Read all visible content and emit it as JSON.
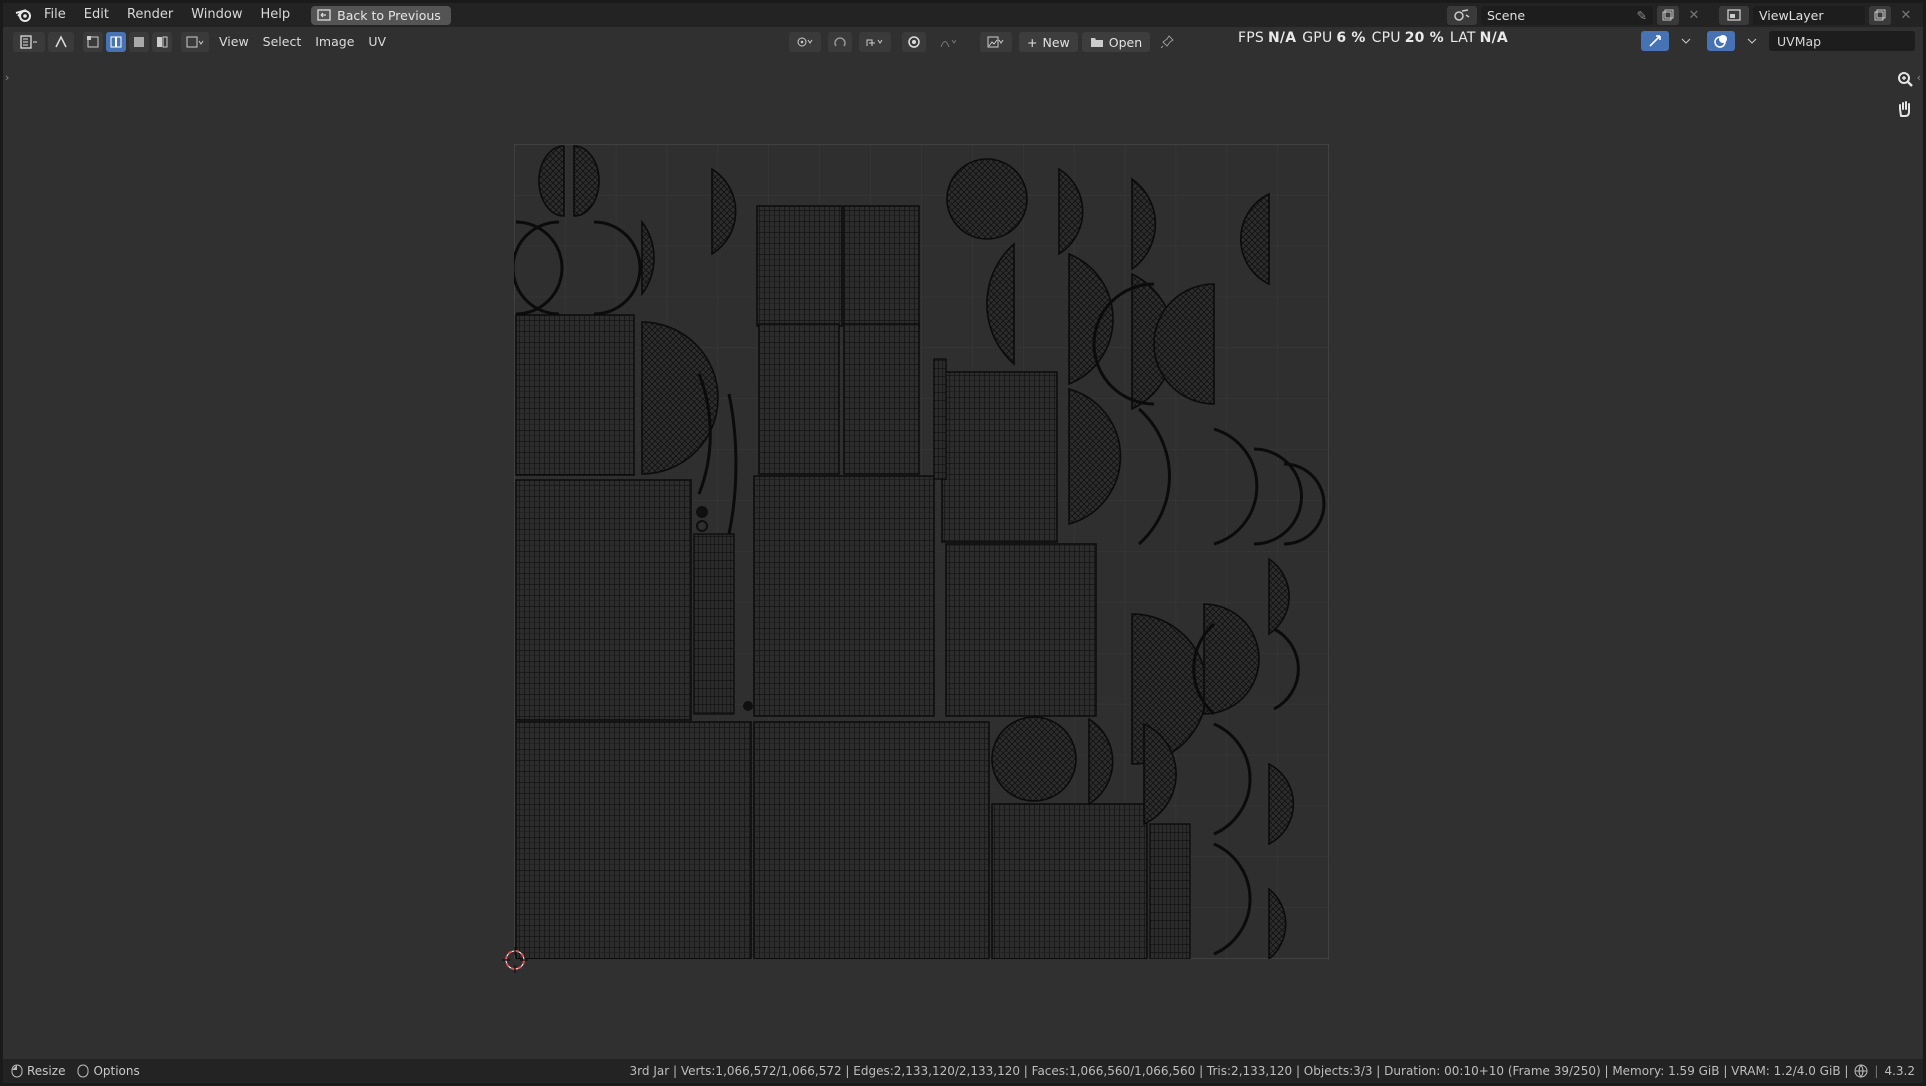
{
  "topbar": {
    "menus": [
      "File",
      "Edit",
      "Render",
      "Window",
      "Help"
    ],
    "back_button": "Back to Previous",
    "scene": "Scene",
    "view_layer": "ViewLayer"
  },
  "header": {
    "menus": [
      "View",
      "Select",
      "Image",
      "UV"
    ],
    "new_label": "New",
    "open_label": "Open",
    "uvmap": "UVMap"
  },
  "stats": {
    "fps_label": "FPS",
    "fps_value": "N/A",
    "gpu_label": "GPU",
    "gpu_value": "6 %",
    "cpu_label": "CPU",
    "cpu_value": "20 %",
    "lat_label": "LAT",
    "lat_value": "N/A"
  },
  "statusbar": {
    "resize": "Resize",
    "options": "Options",
    "info": "3rd Jar | Verts:1,066,572/1,066,572 | Edges:2,133,120/2,133,120 | Faces:1,066,560/1,066,560 | Tris:2,133,120 | Objects:3/3 | Duration: 00:10+10 (Frame 39/250) | Memory: 1.59 GiB | VRAM: 1.2/4.0 GiB |",
    "version": "4.3.2"
  },
  "icons": {
    "logo": "blender-logo-icon",
    "zoom": "zoom-icon",
    "pan": "hand-icon",
    "cursor": "2d-cursor-icon"
  },
  "colors": {
    "accent": "#4772b3",
    "background": "#303030",
    "bar": "#232323",
    "wire": "#0f0f0f",
    "cursor": "#e05050"
  }
}
